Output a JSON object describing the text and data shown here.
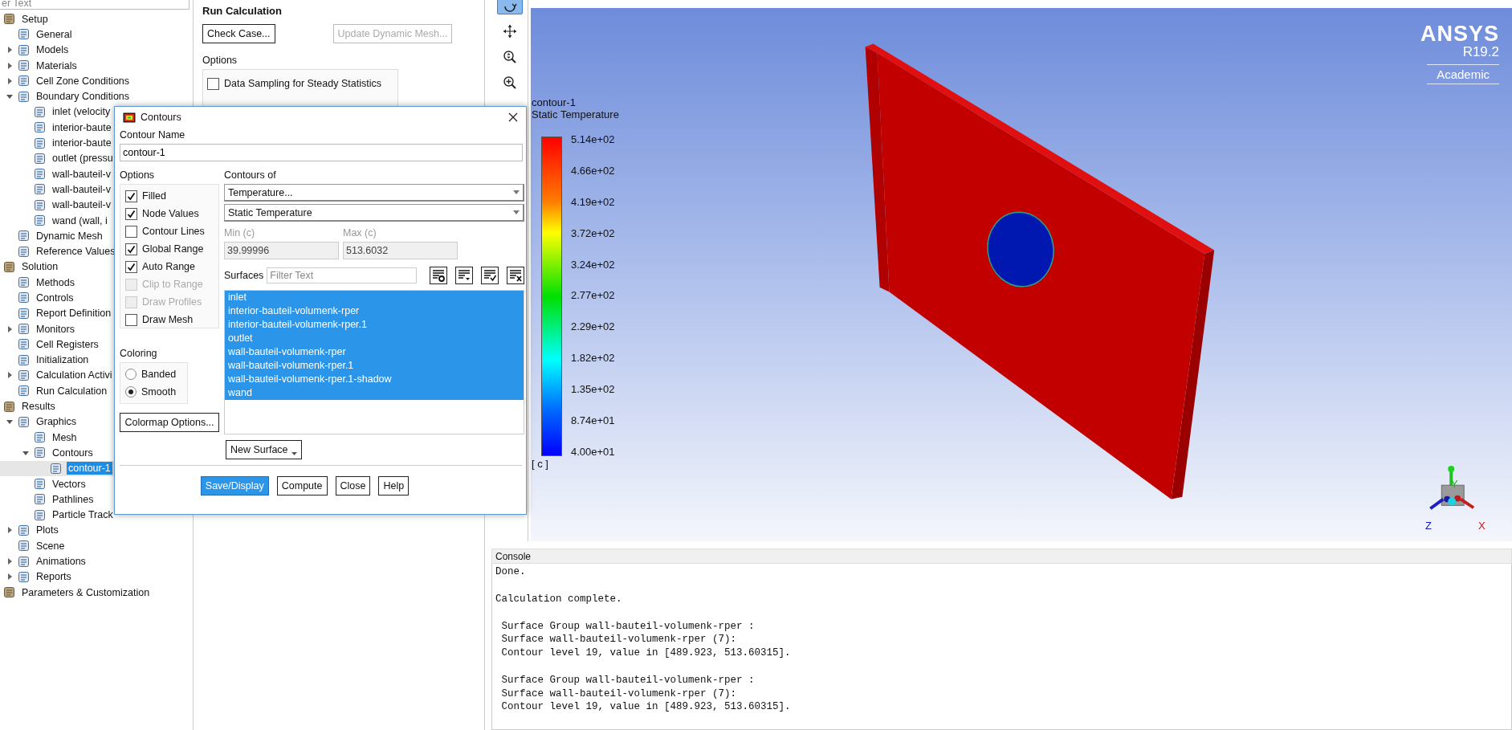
{
  "tree": {
    "filter_field": {
      "placeholder": "er Text"
    },
    "items": [
      {
        "label": "Setup",
        "selected": false,
        "children": [
          {
            "label": "General",
            "selected": false
          },
          {
            "label": "Models",
            "selected": false,
            "expanded": false
          },
          {
            "label": "Materials",
            "selected": false,
            "expanded": false
          },
          {
            "label": "Cell Zone Conditions",
            "selected": false,
            "expanded": false
          },
          {
            "label": "Boundary Conditions",
            "selected": false,
            "expanded": true,
            "children": [
              {
                "label": "inlet (velocity",
                "selected": false
              },
              {
                "label": "interior-baute",
                "selected": false
              },
              {
                "label": "interior-baute",
                "selected": false
              },
              {
                "label": "outlet (pressu",
                "selected": false
              },
              {
                "label": "wall-bauteil-v",
                "selected": false
              },
              {
                "label": "wall-bauteil-v",
                "selected": false
              },
              {
                "label": "wall-bauteil-v",
                "selected": false
              },
              {
                "label": "wand (wall, i",
                "selected": false
              }
            ]
          },
          {
            "label": "Dynamic Mesh",
            "selected": false
          },
          {
            "label": "Reference Values",
            "selected": false
          }
        ]
      },
      {
        "label": "Solution",
        "selected": false,
        "children": [
          {
            "label": "Methods",
            "selected": false
          },
          {
            "label": "Controls",
            "selected": false
          },
          {
            "label": "Report Definition",
            "selected": false
          },
          {
            "label": "Monitors",
            "selected": false,
            "expanded": false
          },
          {
            "label": "Cell Registers",
            "selected": false
          },
          {
            "label": "Initialization",
            "selected": false
          },
          {
            "label": "Calculation Activi",
            "selected": false,
            "expanded": false
          },
          {
            "label": "Run Calculation",
            "selected": false
          }
        ]
      },
      {
        "label": "Results",
        "selected": false,
        "children": [
          {
            "label": "Graphics",
            "selected": false,
            "expanded": true,
            "children": [
              {
                "label": "Mesh",
                "selected": false
              },
              {
                "label": "Contours",
                "selected": false,
                "expanded": true,
                "children": [
                  {
                    "label": "contour-1",
                    "selected": true
                  }
                ]
              },
              {
                "label": "Vectors",
                "selected": false
              },
              {
                "label": "Pathlines",
                "selected": false
              },
              {
                "label": "Particle Track",
                "selected": false
              }
            ]
          },
          {
            "label": "Plots",
            "selected": false,
            "expanded": false
          },
          {
            "label": "Scene",
            "selected": false
          },
          {
            "label": "Animations",
            "selected": false,
            "expanded": false
          },
          {
            "label": "Reports",
            "selected": false,
            "expanded": false
          }
        ]
      },
      {
        "label": "Parameters & Customization",
        "selected": false
      }
    ]
  },
  "task_panel": {
    "title": "Run Calculation",
    "buttons": [
      {
        "label": "Check Case...",
        "disabled": false
      },
      {
        "label": "Update Dynamic Mesh...",
        "disabled": true
      }
    ],
    "options_label": "Options",
    "options": [
      {
        "label": "Data Sampling for Steady Statistics",
        "checked": false
      }
    ]
  },
  "toolbar": [
    {
      "kind": "rotate",
      "selected": true
    },
    {
      "kind": "pan",
      "selected": false
    },
    {
      "kind": "fit",
      "selected": false
    },
    {
      "kind": "zoom",
      "selected": false
    }
  ],
  "graphics": {
    "legend": {
      "title": "contour-1",
      "subtitle": "Static Temperature",
      "labels": [
        "5.14e+02",
        "4.66e+02",
        "4.19e+02",
        "3.72e+02",
        "3.24e+02",
        "2.77e+02",
        "2.29e+02",
        "1.82e+02",
        "1.35e+02",
        "8.74e+01",
        "4.00e+01"
      ],
      "unit": "[ c ]"
    },
    "logo": {
      "name": "ANSYS",
      "version": "R19.2",
      "edition": "Academic"
    },
    "axes": [
      "Y",
      "Z",
      "X"
    ]
  },
  "dialog": {
    "title": "Contours",
    "name_label": "Contour Name",
    "name_value": "contour-1",
    "options_label": "Options",
    "options": [
      {
        "label": "Filled",
        "checked": true,
        "disabled": false
      },
      {
        "label": "Node Values",
        "checked": true,
        "disabled": false
      },
      {
        "label": "Contour Lines",
        "checked": false,
        "disabled": false
      },
      {
        "label": "Global Range",
        "checked": true,
        "disabled": false
      },
      {
        "label": "Auto Range",
        "checked": true,
        "disabled": false
      },
      {
        "label": "Clip to Range",
        "checked": false,
        "disabled": true
      },
      {
        "label": "Draw Profiles",
        "checked": false,
        "disabled": true
      },
      {
        "label": "Draw Mesh",
        "checked": false,
        "disabled": false
      }
    ],
    "contours_of_label": "Contours of",
    "field": "Temperature...",
    "subfield": "Static Temperature",
    "min": {
      "label": "Min (c)",
      "value": "39.99996",
      "disabled": true
    },
    "max": {
      "label": "Max (c)",
      "value": "513.6032",
      "disabled": true
    },
    "surfaces_label": "Surfaces",
    "filter_placeholder": "Filter Text",
    "surfaces": [
      {
        "label": "inlet",
        "selected": true
      },
      {
        "label": "interior-bauteil-volumenk-rper",
        "selected": true
      },
      {
        "label": "interior-bauteil-volumenk-rper.1",
        "selected": true
      },
      {
        "label": "outlet",
        "selected": true
      },
      {
        "label": "wall-bauteil-volumenk-rper",
        "selected": true
      },
      {
        "label": "wall-bauteil-volumenk-rper.1",
        "selected": true
      },
      {
        "label": "wall-bauteil-volumenk-rper.1-shadow",
        "selected": true
      },
      {
        "label": "wand",
        "selected": true
      }
    ],
    "coloring_label": "Coloring",
    "coloring": [
      {
        "label": "Banded",
        "selected": false
      },
      {
        "label": "Smooth",
        "selected": true
      }
    ],
    "colormap_button": "Colormap Options...",
    "new_surface_button": "New Surface",
    "buttons": [
      {
        "label": "Save/Display",
        "default": true
      },
      {
        "label": "Compute",
        "default": false
      },
      {
        "label": "Close",
        "default": false
      },
      {
        "label": "Help",
        "default": false
      }
    ]
  },
  "console": {
    "title": "Console",
    "blocks": [
      [
        "Done."
      ],
      [
        "Calculation complete."
      ],
      [
        " Surface Group wall-bauteil-volumenk-rper :",
        " Surface wall-bauteil-volumenk-rper (7):",
        " Contour level 19, value in [489.923, 513.60315]."
      ],
      [
        " Surface Group wall-bauteil-volumenk-rper :",
        " Surface wall-bauteil-volumenk-rper (7):",
        " Contour level 19, value in [489.923, 513.60315]."
      ]
    ]
  }
}
